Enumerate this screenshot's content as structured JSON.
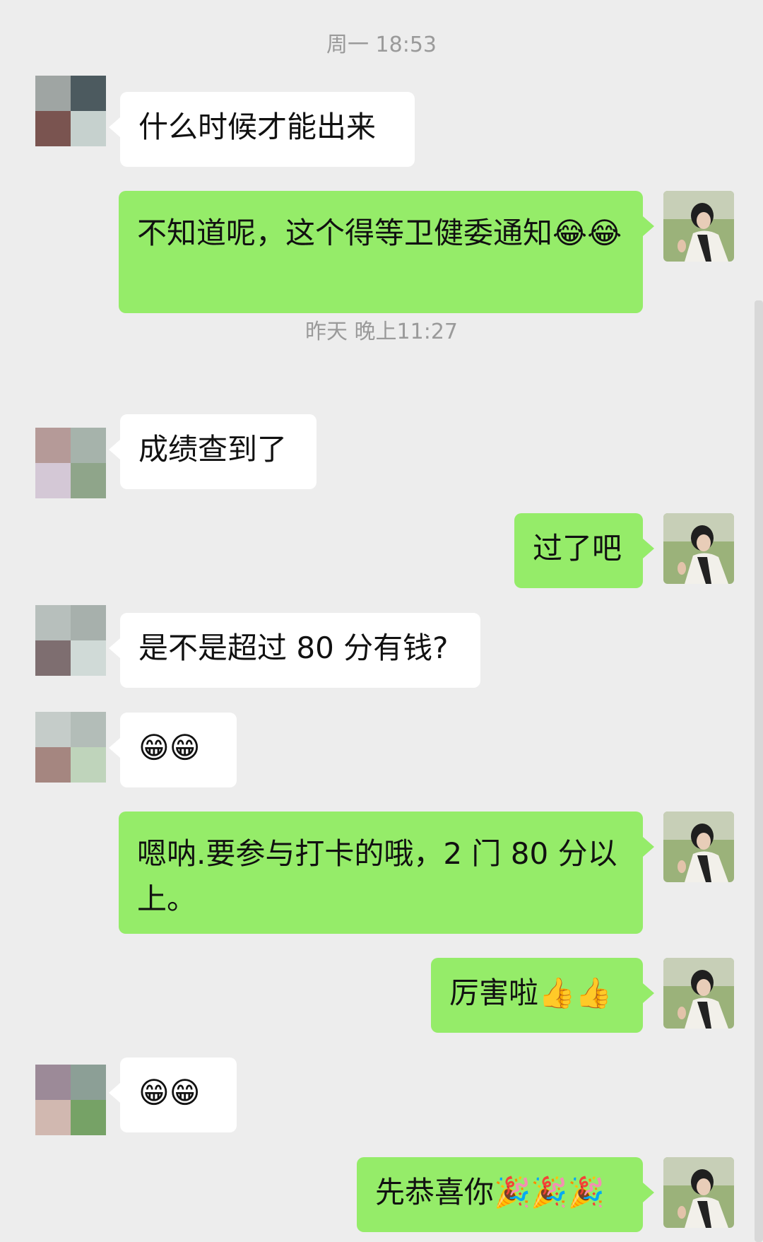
{
  "timestamps": {
    "first": "周一 18:53",
    "second": "昨天 晚上11:27"
  },
  "messages": [
    {
      "from": "contact",
      "text": "什么时候才能出来"
    },
    {
      "from": "me",
      "text": "不知道呢，这个得等卫健委通知😂😂"
    },
    {
      "from": "contact",
      "text": "成绩查到了"
    },
    {
      "from": "me",
      "text": "过了吧"
    },
    {
      "from": "contact",
      "text": "是不是超过 80 分有钱?"
    },
    {
      "from": "contact",
      "text": "😁😁"
    },
    {
      "from": "me",
      "text": "嗯呐.要参与打卡的哦，2 门 80 分以上。"
    },
    {
      "from": "me",
      "text": "厉害啦👍👍"
    },
    {
      "from": "contact",
      "text": "😁😁"
    },
    {
      "from": "me",
      "text": "先恭喜你🎉🎉🎉"
    }
  ],
  "colors": {
    "background": "#ededed",
    "incoming_bubble": "#ffffff",
    "outgoing_bubble": "#95ec69",
    "timestamp_text": "#9a9a9a"
  },
  "icons": {
    "contact_avatar": "pixelated-avatar-icon",
    "my_avatar": "woman-photo-avatar-icon"
  }
}
